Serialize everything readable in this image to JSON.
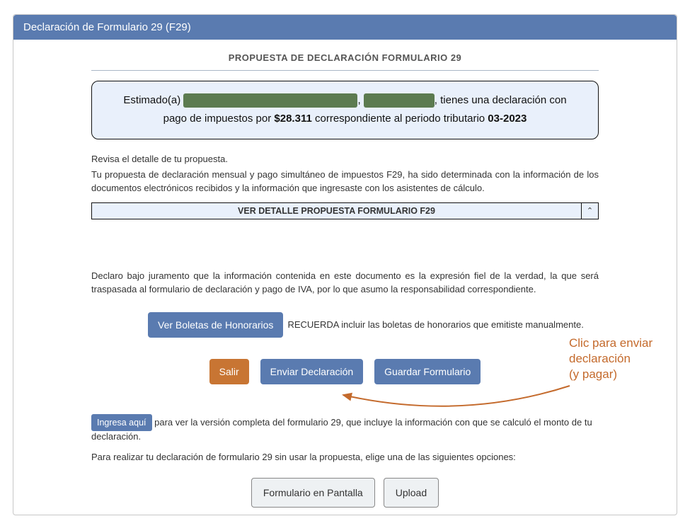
{
  "header": {
    "title": "Declaración de Formulario 29 (F29)"
  },
  "section_title": "PROPUESTA DE DECLARACIÓN FORMULARIO 29",
  "greeting": {
    "prefix": "Estimado(a) ",
    "mid": ", ",
    "tail_1": ", tienes una declaración con pago de impuestos por ",
    "amount": "$28.311",
    "tail_2": " correspondiente al periodo tributario ",
    "period": "03-2023"
  },
  "intro_1": "Revisa el detalle de tu propuesta.",
  "intro_2": "Tu propuesta de declaración mensual y pago simultáneo de impuestos F29, ha sido determinada con la información de los documentos electrónicos recibidos y la información que ingresaste con los asistentes de cálculo.",
  "collapse": {
    "title": "VER DETALLE PROPUESTA FORMULARIO F29",
    "glyph": "⌃"
  },
  "declaration": "Declaro bajo juramento que la información contenida en este documento es la expresión fiel de la verdad, la que será traspasada al formulario de declaración y pago de IVA, por lo que asumo la responsabilidad correspondiente.",
  "boletas_btn": "Ver Boletas de Honorarios",
  "reminder": "RECUERDA incluir las boletas de honorarios que emitiste manualmente.",
  "actions": {
    "salir": "Salir",
    "enviar": "Enviar Declaración",
    "guardar": "Guardar Formulario"
  },
  "ingresa_btn": "Ingresa aquí",
  "ingresa_text": " para ver la versión completa del formulario 29, que incluye la información con que se calculó el monto de tu declaración.",
  "subnote": "Para realizar tu declaración de formulario 29 sin usar la propuesta, elige una de las siguientes opciones:",
  "bottom": {
    "pantalla": "Formulario en Pantalla",
    "upload": "Upload"
  },
  "callout": {
    "line1": "Clic para enviar",
    "line2": "declaración",
    "line3": "(y pagar)"
  }
}
